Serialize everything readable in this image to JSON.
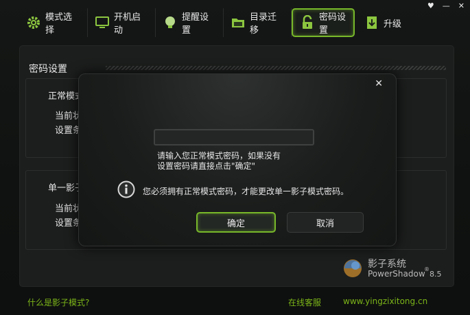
{
  "window": {
    "controls": [
      "♥",
      "—",
      "✕"
    ]
  },
  "toolbar": {
    "items": [
      {
        "label": "模式选择",
        "icon": "gear-icon"
      },
      {
        "label": "开机启动",
        "icon": "monitor-icon"
      },
      {
        "label": "提醒设置",
        "icon": "bulb-icon"
      },
      {
        "label": "目录迁移",
        "icon": "folder-icon"
      },
      {
        "label": "密码设置",
        "icon": "lock-icon",
        "active": true
      },
      {
        "label": "升级",
        "icon": "download-icon"
      }
    ]
  },
  "main": {
    "title": "密码设置",
    "group1": {
      "title": "正常模式",
      "line1": "当前状",
      "line2": "设置条"
    },
    "group2": {
      "title": "单一影子",
      "line1": "当前状",
      "line2": "设置条"
    }
  },
  "brand": {
    "name": "影子系统",
    "product": "PowerShadow",
    "reg": "®",
    "version": "8.5"
  },
  "footer": {
    "help_link": "什么是影子模式?",
    "support_link": "在线客服",
    "website_link": "www.yingzixitong.cn"
  },
  "dialog": {
    "close": "✕",
    "password_value": "",
    "hint_line1": "请输入您正常模式密码，如果没有",
    "hint_line2": "设置密码请直接点击\"确定\"",
    "info_text": "您必须拥有正常模式密码，才能更改单一影子模式密码。",
    "ok_label": "确定",
    "cancel_label": "取消"
  },
  "colors": {
    "accent": "#78b82a",
    "link": "#7cb518",
    "background": "#111312"
  }
}
